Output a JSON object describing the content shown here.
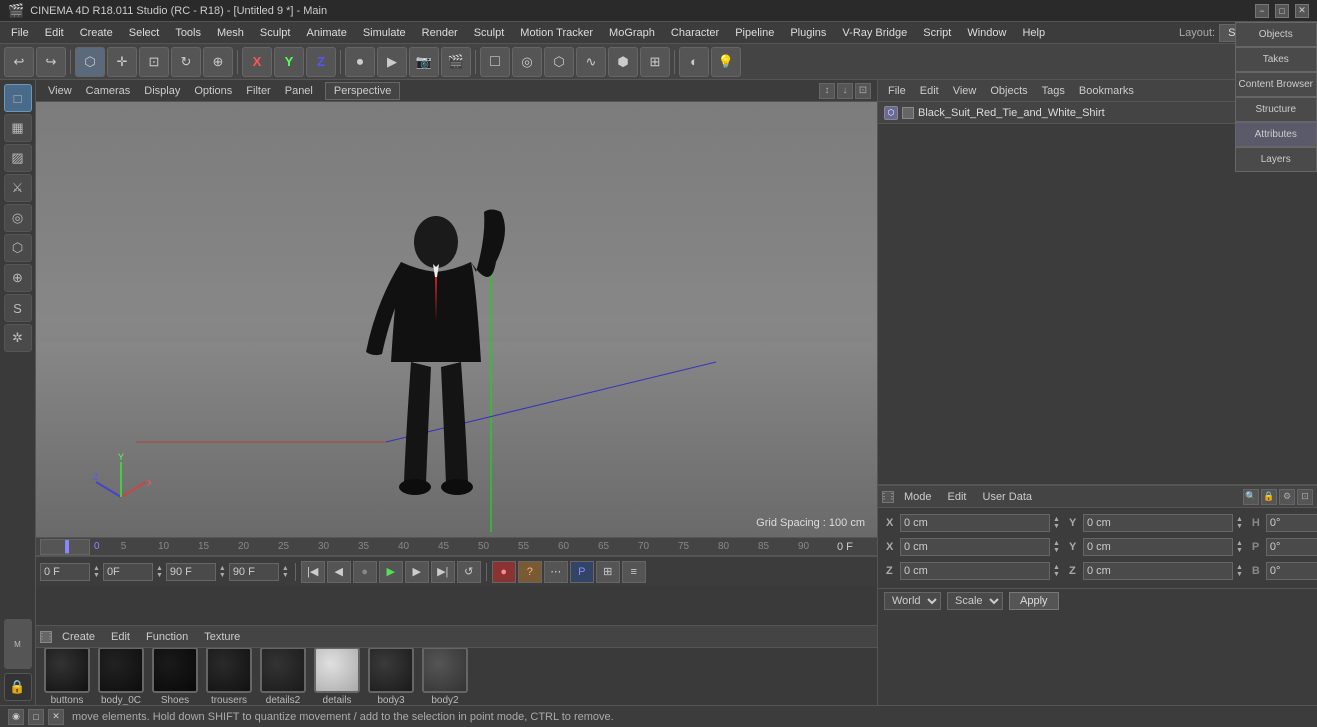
{
  "titleBar": {
    "title": "CINEMA 4D R18.011 Studio (RC - R18) - [Untitled 9 *] - Main",
    "minimize": "−",
    "maximize": "□",
    "close": "✕"
  },
  "menuBar": {
    "items": [
      "File",
      "Edit",
      "Create",
      "Select",
      "Tools",
      "Mesh",
      "Sculpt",
      "Animate",
      "Simulate",
      "Render",
      "Sculpt",
      "Motion Tracker",
      "MoGraph",
      "Character",
      "Pipeline",
      "Plugins",
      "V-Ray Bridge",
      "Script",
      "Window",
      "Help"
    ],
    "layout_label": "Layout:",
    "layout_value": "Startup"
  },
  "viewport": {
    "label": "Perspective",
    "grid_spacing": "Grid Spacing : 100 cm",
    "menus": [
      "View",
      "Cameras",
      "Display",
      "Options",
      "Filter",
      "Panel"
    ]
  },
  "rightPanel": {
    "menus": [
      "File",
      "Edit",
      "View",
      "Objects",
      "Tags",
      "Bookmarks"
    ],
    "objectName": "Black_Suit_Red_Tie_and_White_Shirt",
    "colorDot": "#5599ff"
  },
  "attributesPanel": {
    "mode_label": "Mode",
    "edit_label": "Edit",
    "userdata_label": "User Data",
    "fields": {
      "X_pos": "0 cm",
      "Y_pos": "0 cm",
      "Z_pos": "0 cm",
      "X_rot": "0°",
      "Y_rot": "0°",
      "Z_rot": "0°",
      "X_size": "H",
      "Y_size": "P",
      "Z_size": "B",
      "X_suffix": "°",
      "Y_suffix": "°",
      "Z_suffix": "°"
    },
    "world_label": "World",
    "scale_label": "Scale",
    "apply_label": "Apply"
  },
  "timeline": {
    "markers": [
      "0",
      "5",
      "10",
      "15",
      "20",
      "25",
      "30",
      "35",
      "40",
      "45",
      "50",
      "55",
      "60",
      "65",
      "70",
      "75",
      "80",
      "85",
      "90"
    ],
    "current_frame": "0 F",
    "transport": {
      "start_frame": "0 F",
      "end_frame": "90 F",
      "current": "0 F",
      "preview_start": "0F",
      "preview_end": "90F"
    }
  },
  "materials": {
    "toolbar": [
      "Create",
      "Edit",
      "Function",
      "Texture"
    ],
    "items": [
      {
        "label": "buttons",
        "color": "#1a1a1a"
      },
      {
        "label": "body_0C",
        "color": "#111111"
      },
      {
        "label": "Shoes",
        "color": "#0d0d0d"
      },
      {
        "label": "trousers",
        "color": "#141414"
      },
      {
        "label": "details2",
        "color": "#1a1a1a"
      },
      {
        "label": "details",
        "color": "#b0b0b0"
      },
      {
        "label": "body3",
        "color": "#222222"
      },
      {
        "label": "body2",
        "color": "#333333"
      }
    ]
  },
  "statusBar": {
    "message": "move elements. Hold down SHIFT to quantize movement / add to the selection in point mode, CTRL to remove."
  },
  "verticalTabs": {
    "right": [
      "Objects",
      "Takes",
      "Content Browser",
      "Structure",
      "Attributes",
      "Layers"
    ]
  },
  "icons": {
    "undo": "↩",
    "redo": "↪",
    "move": "✛",
    "scale": "⊡",
    "rotate": "↻",
    "axis_x": "X",
    "axis_y": "Y",
    "axis_z": "Z",
    "world": "⊕",
    "play": "▶",
    "stop": "■",
    "prev": "◀◀",
    "next": "▶▶",
    "first": "◀|",
    "last": "|▶",
    "record": "●"
  }
}
